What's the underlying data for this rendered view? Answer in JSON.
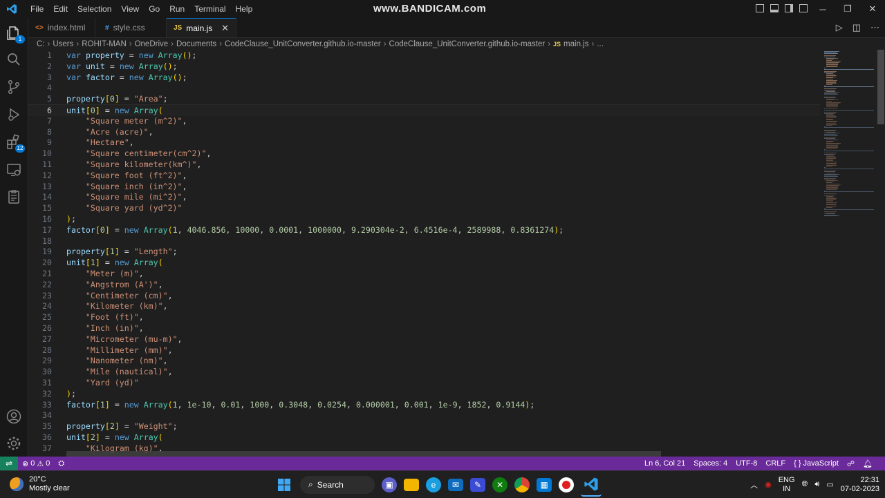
{
  "titlebar": {
    "menu": [
      "File",
      "Edit",
      "Selection",
      "View",
      "Go",
      "Run",
      "Terminal",
      "Help"
    ],
    "watermark": "www.BANDICAM.com"
  },
  "activity": {
    "explorer_badge": "1",
    "extensions_badge": "12"
  },
  "tabs": [
    {
      "icon": "<>",
      "label": "index.html"
    },
    {
      "icon": "#",
      "label": "style.css"
    },
    {
      "icon": "JS",
      "label": "main.js",
      "close": "✕"
    }
  ],
  "breadcrumb": [
    "C:",
    "Users",
    "ROHIT-MAN",
    "OneDrive",
    "Documents",
    "CodeClause_UnitConverter.github.io-master",
    "CodeClause_UnitConverter.github.io-master",
    "main.js",
    "..."
  ],
  "editor": {
    "current_line": 6,
    "lines": [
      {
        "n": "1",
        "code": "var property = new Array();"
      },
      {
        "n": "2",
        "code": "var unit = new Array();"
      },
      {
        "n": "3",
        "code": "var factor = new Array();"
      },
      {
        "n": "4",
        "code": ""
      },
      {
        "n": "5",
        "code": "property[0] = \"Area\";"
      },
      {
        "n": "6",
        "code": "unit[0] = new Array("
      },
      {
        "n": "7",
        "code": "    \"Square meter (m^2)\","
      },
      {
        "n": "8",
        "code": "    \"Acre (acre)\","
      },
      {
        "n": "9",
        "code": "    \"Hectare\","
      },
      {
        "n": "10",
        "code": "    \"Square centimeter(cm^2)\","
      },
      {
        "n": "11",
        "code": "    \"Square kilometer(km^)\","
      },
      {
        "n": "12",
        "code": "    \"Square foot (ft^2)\","
      },
      {
        "n": "13",
        "code": "    \"Square inch (in^2)\","
      },
      {
        "n": "14",
        "code": "    \"Square mile (mi^2)\","
      },
      {
        "n": "15",
        "code": "    \"Square yard (yd^2)\""
      },
      {
        "n": "16",
        "code": ");"
      },
      {
        "n": "17",
        "code": "factor[0] = new Array(1, 4046.856, 10000, 0.0001, 1000000, 9.290304e-2, 6.4516e-4, 2589988, 0.8361274);"
      },
      {
        "n": "18",
        "code": ""
      },
      {
        "n": "19",
        "code": "property[1] = \"Length\";"
      },
      {
        "n": "20",
        "code": "unit[1] = new Array("
      },
      {
        "n": "21",
        "code": "    \"Meter (m)\","
      },
      {
        "n": "22",
        "code": "    \"Angstrom (A')\","
      },
      {
        "n": "23",
        "code": "    \"Centimeter (cm)\","
      },
      {
        "n": "24",
        "code": "    \"Kilometer (km)\","
      },
      {
        "n": "25",
        "code": "    \"Foot (ft)\","
      },
      {
        "n": "26",
        "code": "    \"Inch (in)\","
      },
      {
        "n": "27",
        "code": "    \"Micrometer (mu-m)\","
      },
      {
        "n": "28",
        "code": "    \"Millimeter (mm)\","
      },
      {
        "n": "29",
        "code": "    \"Nanometer (nm)\","
      },
      {
        "n": "30",
        "code": "    \"Mile (nautical)\","
      },
      {
        "n": "31",
        "code": "    \"Yard (yd)\""
      },
      {
        "n": "32",
        "code": ");"
      },
      {
        "n": "33",
        "code": "factor[1] = new Array(1, 1e-10, 0.01, 1000, 0.3048, 0.0254, 0.000001, 0.001, 1e-9, 1852, 0.9144);"
      },
      {
        "n": "34",
        "code": ""
      },
      {
        "n": "35",
        "code": "property[2] = \"Weight\";"
      },
      {
        "n": "36",
        "code": "unit[2] = new Array("
      },
      {
        "n": "37",
        "code": "    \"Kilogram (kg)\","
      }
    ]
  },
  "statusbar": {
    "errors": "0",
    "warnings": "0",
    "position": "Ln 6, Col 21",
    "spaces": "Spaces: 4",
    "encoding": "UTF-8",
    "eol": "CRLF",
    "language": "JavaScript"
  },
  "taskbar": {
    "temperature": "20°C",
    "weather": "Mostly clear",
    "search": "Search",
    "lang1": "ENG",
    "lang2": "IN",
    "time": "22:31",
    "date": "07-02-2023"
  }
}
